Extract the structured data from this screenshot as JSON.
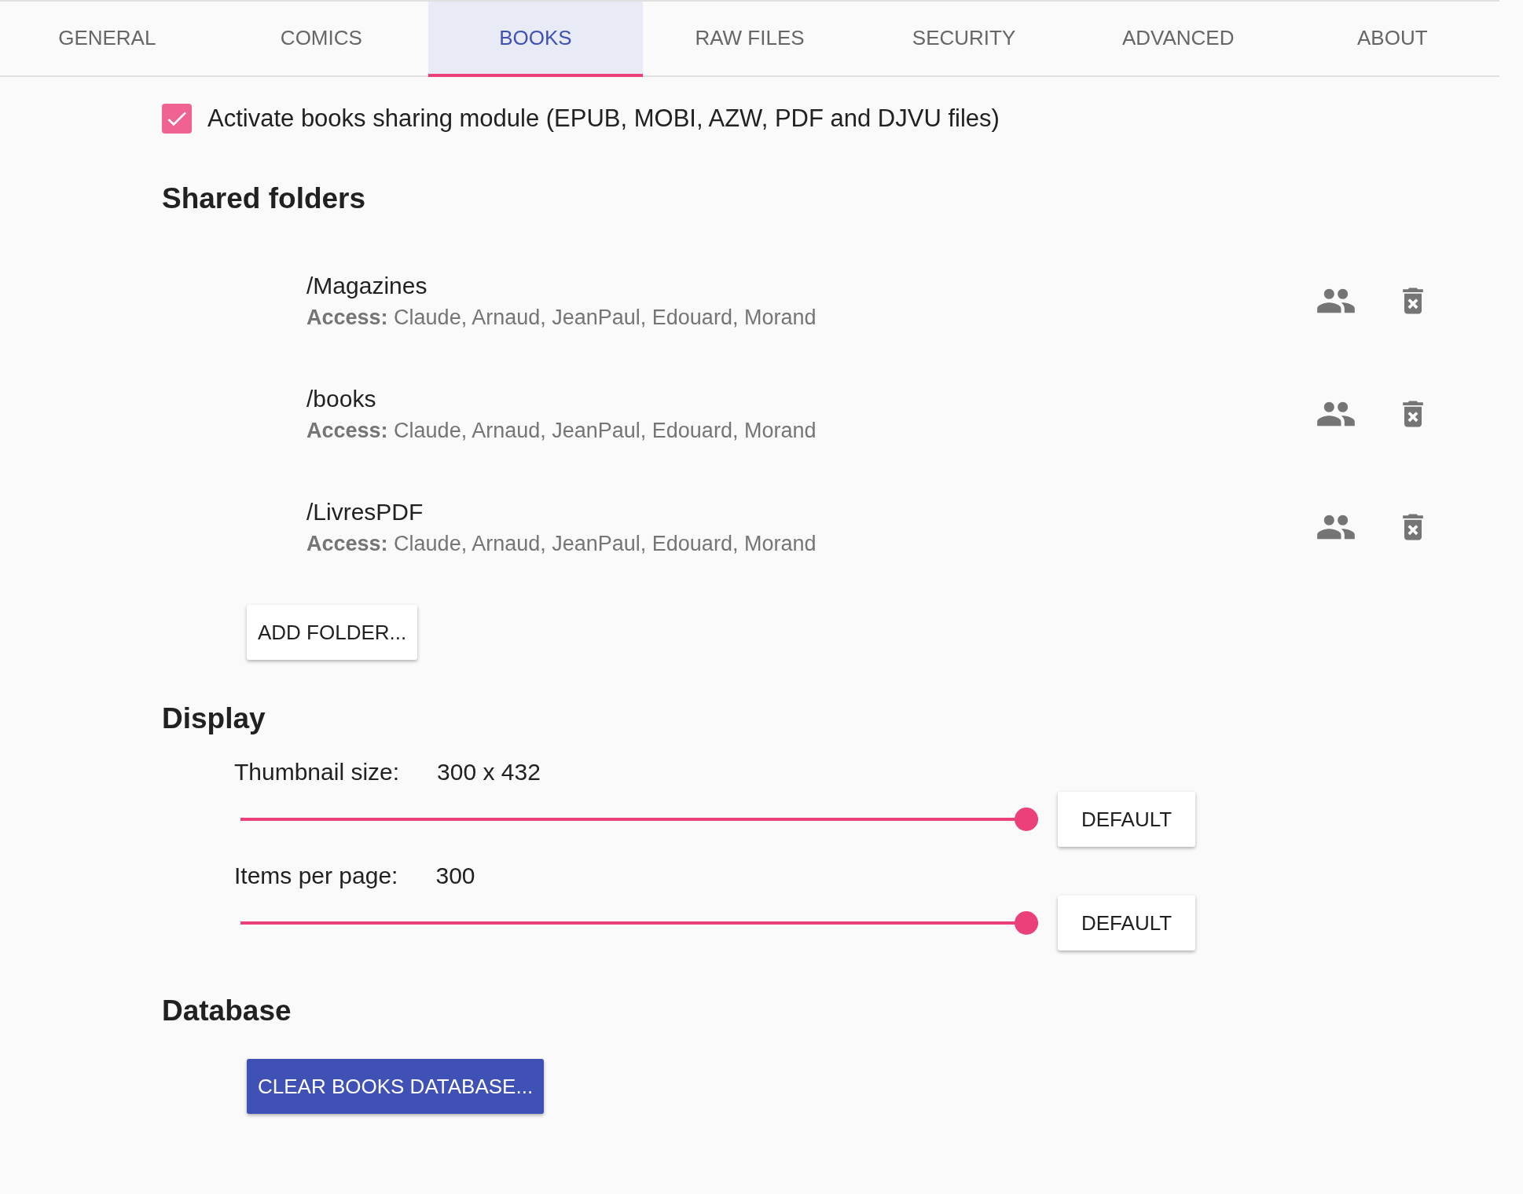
{
  "tabs": [
    {
      "label": "GENERAL",
      "selected": false
    },
    {
      "label": "COMICS",
      "selected": false
    },
    {
      "label": "BOOKS",
      "selected": true
    },
    {
      "label": "RAW FILES",
      "selected": false
    },
    {
      "label": "SECURITY",
      "selected": false
    },
    {
      "label": "ADVANCED",
      "selected": false
    },
    {
      "label": "ABOUT",
      "selected": false
    }
  ],
  "activate": {
    "label": "Activate books sharing module (EPUB, MOBI, AZW, PDF and DJVU files)",
    "checked": true
  },
  "shared_folders": {
    "heading": "Shared folders",
    "folders": [
      {
        "path": "/Magazines",
        "access": "**Access:** Claude, Arnaud, JeanPaul, Edouard, Morand"
      },
      {
        "path": "/books",
        "access": "**Access:** Claude, Arnaud, JeanPaul, Edouard, Morand"
      },
      {
        "path": "/LivresPDF",
        "access": "**Access:** Claude, Arnaud, JeanPaul, Edouard, Morand"
      }
    ],
    "add_button": "ADD FOLDER..."
  },
  "display": {
    "heading": "Display",
    "settings": [
      {
        "label": "Thumbnail size:",
        "value": "300 x 432",
        "level": 1,
        "button": "DEFAULT"
      },
      {
        "label": "Items per page:",
        "value": "300",
        "level": 1,
        "button": "DEFAULT"
      }
    ]
  },
  "database": {
    "heading": "Database",
    "button": "CLEAR BOOKS DATABASE..."
  }
}
